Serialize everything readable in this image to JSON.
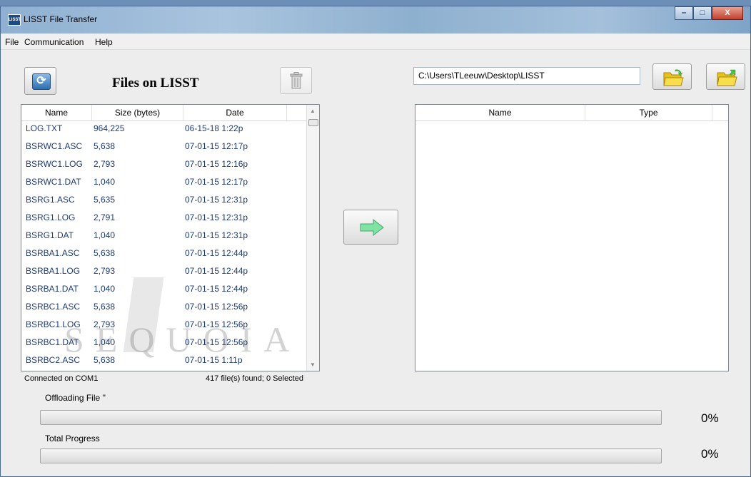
{
  "window": {
    "title": "LISST File Transfer",
    "app_icon_text": "LISST",
    "controls": {
      "minimize": "‒",
      "maximize": "□",
      "close": "X"
    }
  },
  "menu": [
    {
      "label": "File"
    },
    {
      "label": "Communication"
    },
    {
      "label": "Help"
    }
  ],
  "left_panel": {
    "title": "Files on LISST",
    "columns": [
      "Name",
      "Size (bytes)",
      "Date"
    ],
    "rows": [
      [
        "LOG.TXT",
        "964,225",
        "06-15-18 1:22p"
      ],
      [
        "BSRWC1.ASC",
        "5,638",
        "07-01-15 12:17p"
      ],
      [
        "BSRWC1.LOG",
        "2,793",
        "07-01-15 12:16p"
      ],
      [
        "BSRWC1.DAT",
        "1,040",
        "07-01-15 12:17p"
      ],
      [
        "BSRG1.ASC",
        "5,635",
        "07-01-15 12:31p"
      ],
      [
        "BSRG1.LOG",
        "2,791",
        "07-01-15 12:31p"
      ],
      [
        "BSRG1.DAT",
        "1,040",
        "07-01-15 12:31p"
      ],
      [
        "BSRBA1.ASC",
        "5,638",
        "07-01-15 12:44p"
      ],
      [
        "BSRBA1.LOG",
        "2,793",
        "07-01-15 12:44p"
      ],
      [
        "BSRBA1.DAT",
        "1,040",
        "07-01-15 12:44p"
      ],
      [
        "BSRBC1.ASC",
        "5,638",
        "07-01-15 12:56p"
      ],
      [
        "BSRBC1.LOG",
        "2,793",
        "07-01-15 12:56p"
      ],
      [
        "BSRBC1.DAT",
        "1,040",
        "07-01-15 12:56p"
      ],
      [
        "BSRBC2.ASC",
        "5,638",
        "07-01-15 1:11p"
      ]
    ],
    "watermark": "SEQUOIA"
  },
  "status": {
    "connection": "Connected on COM1",
    "files_found": "417 file(s) found; 0 Selected"
  },
  "right_panel": {
    "path": "C:\\Users\\TLeeuw\\Desktop\\LISST",
    "columns": [
      "Name",
      "Type"
    ]
  },
  "progress": {
    "offload_label": "Offloading File ''",
    "offload_percent": "0%",
    "offload_value": 0,
    "total_label": "Total Progress",
    "total_percent": "0%",
    "total_value": 0
  },
  "colors": {
    "accent": "#1e3b7a",
    "arrow": "#5fd08a"
  }
}
